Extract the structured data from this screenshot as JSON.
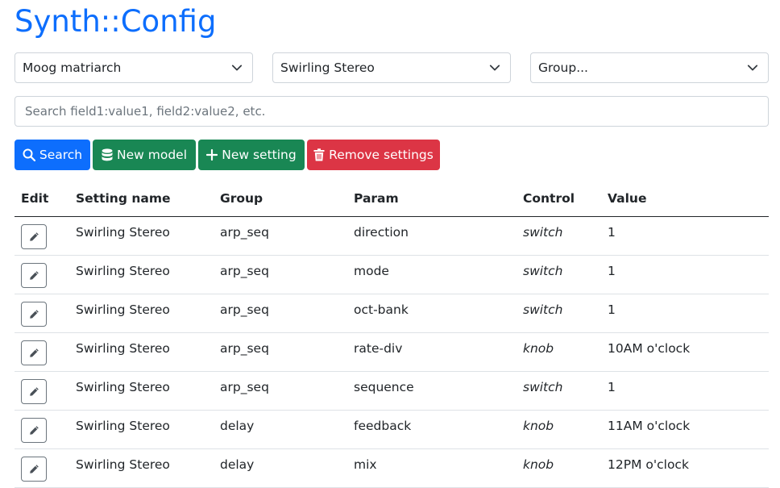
{
  "app": {
    "title": "Synth::Config"
  },
  "filters": {
    "model": "Moog matriarch",
    "setting": "Swirling Stereo",
    "group": "Group..."
  },
  "search": {
    "placeholder": "Search field1:value1, field2:value2, etc.",
    "value": ""
  },
  "toolbar": {
    "search_label": "Search",
    "new_model_label": "New model",
    "new_setting_label": "New setting",
    "remove_label": "Remove settings"
  },
  "colors": {
    "primary": "#0d6efd",
    "success": "#198754",
    "danger": "#dc3545"
  },
  "table": {
    "headers": [
      "Edit",
      "Setting name",
      "Group",
      "Param",
      "Control",
      "Value"
    ],
    "rows": [
      {
        "setting": "Swirling Stereo",
        "group": "arp_seq",
        "param": "direction",
        "control": "switch",
        "value": "1"
      },
      {
        "setting": "Swirling Stereo",
        "group": "arp_seq",
        "param": "mode",
        "control": "switch",
        "value": "1"
      },
      {
        "setting": "Swirling Stereo",
        "group": "arp_seq",
        "param": "oct-bank",
        "control": "switch",
        "value": "1"
      },
      {
        "setting": "Swirling Stereo",
        "group": "arp_seq",
        "param": "rate-div",
        "control": "knob",
        "value": "10AM o'clock"
      },
      {
        "setting": "Swirling Stereo",
        "group": "arp_seq",
        "param": "sequence",
        "control": "switch",
        "value": "1"
      },
      {
        "setting": "Swirling Stereo",
        "group": "delay",
        "param": "feedback",
        "control": "knob",
        "value": "11AM o'clock"
      },
      {
        "setting": "Swirling Stereo",
        "group": "delay",
        "param": "mix",
        "control": "knob",
        "value": "12PM o'clock"
      }
    ]
  }
}
